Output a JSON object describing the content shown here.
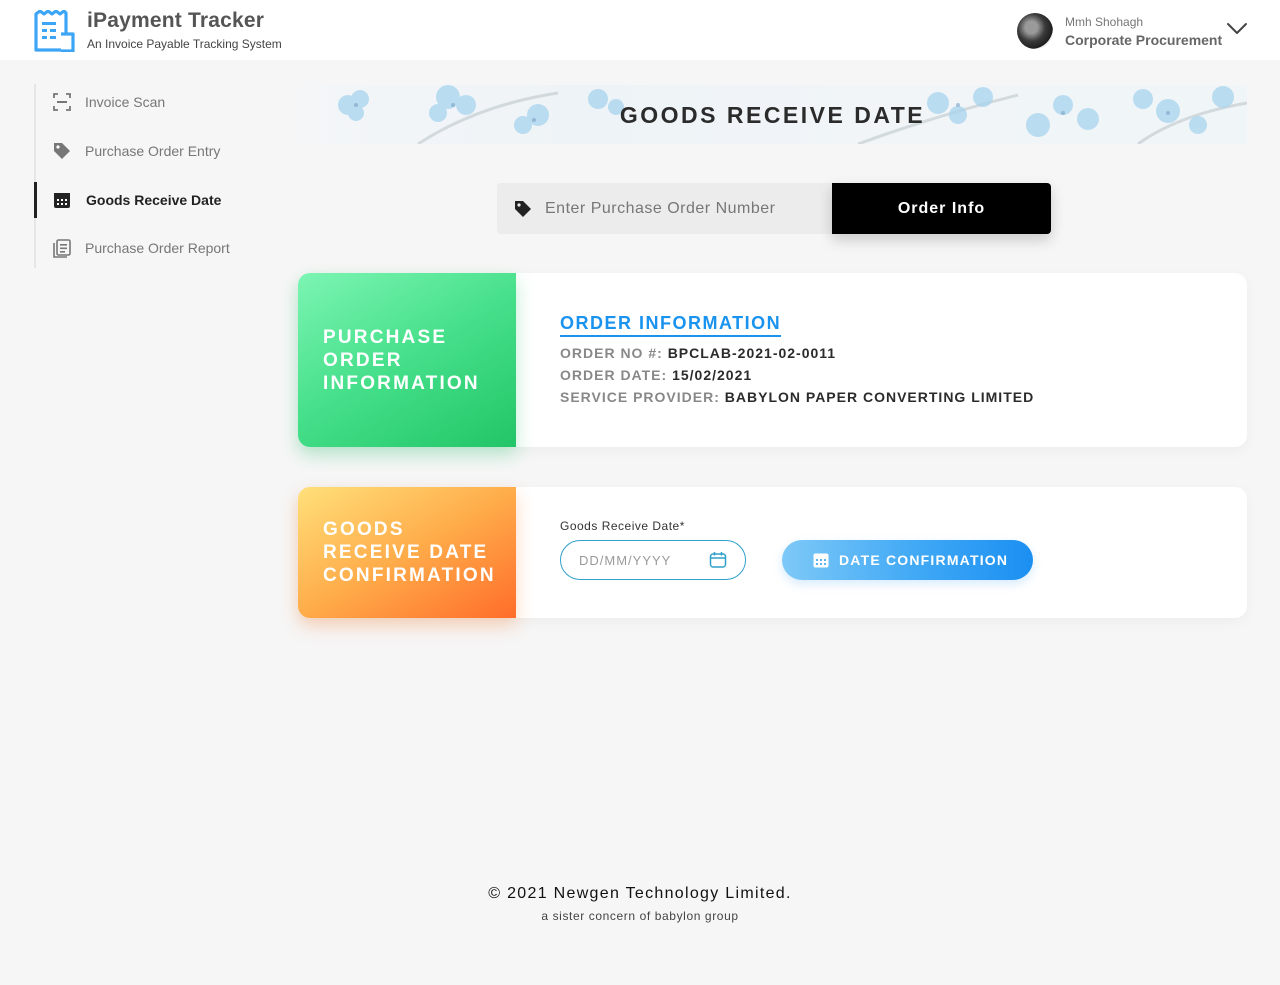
{
  "header": {
    "app_title": "iPayment Tracker",
    "app_subtitle": "An Invoice Payable Tracking System",
    "user": {
      "name": "Mmh Shohagh",
      "role": "Corporate Procurement"
    }
  },
  "sidebar": {
    "items": [
      {
        "label": "Invoice Scan",
        "icon": "scan-icon",
        "active": false
      },
      {
        "label": "Purchase Order Entry",
        "icon": "tag-icon",
        "active": false
      },
      {
        "label": "Goods Receive Date",
        "icon": "calendar-icon",
        "active": true
      },
      {
        "label": "Purchase Order Report",
        "icon": "report-icon",
        "active": false
      }
    ]
  },
  "banner": {
    "title": "GOODS RECEIVE DATE"
  },
  "search": {
    "placeholder": "Enter Purchase Order Number",
    "button_label": "Order Info"
  },
  "order_card": {
    "side_title": "PURCHASE\nORDER\nINFORMATION",
    "heading": "ORDER INFORMATION",
    "order_no_label": "ORDER NO #:",
    "order_no": "BPCLAB-2021-02-0011",
    "order_date_label": "ORDER DATE:",
    "order_date": "15/02/2021",
    "provider_label": "SERVICE PROVIDER:",
    "provider": "BABYLON PAPER CONVERTING LIMITED"
  },
  "confirm_card": {
    "side_title": "GOODS\nRECEIVE DATE\nCONFIRMATION",
    "field_label": "Goods Receive Date*",
    "field_placeholder": "DD/MM/YYYY",
    "button_label": "DATE CONFIRMATION"
  },
  "footer": {
    "copyright": "© 2021 Newgen Technology Limited.",
    "tagline": "a sister concern of babylon group"
  },
  "colors": {
    "accent_blue": "#1a93ef",
    "green_start": "#7cf5b3",
    "green_end": "#22c567",
    "orange_start": "#ffe07a",
    "orange_end": "#ff6d2a",
    "dark": "#000000",
    "logo_blue": "#3da5f5"
  }
}
